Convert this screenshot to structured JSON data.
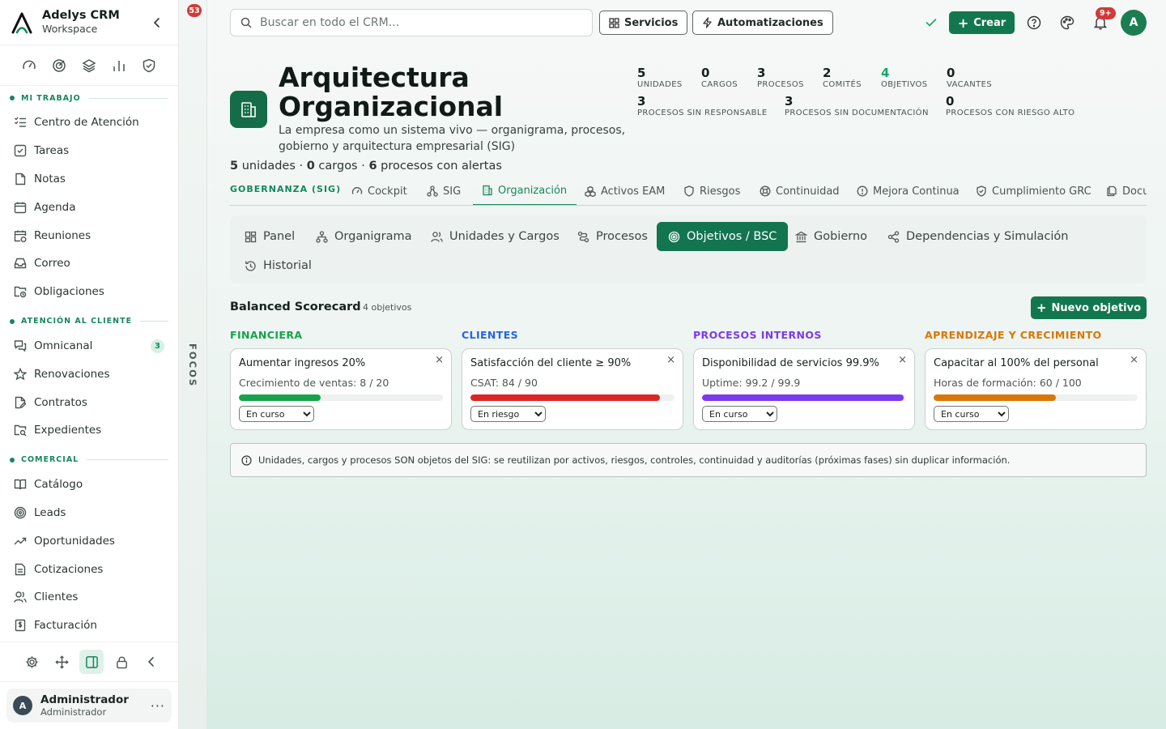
{
  "brand": {
    "name": "Adelys CRM",
    "sub": "Workspace"
  },
  "sidebar": {
    "sections": [
      {
        "label": "MI TRABAJO",
        "items": [
          {
            "label": "Centro de Atención",
            "icon": "list-check-icon"
          },
          {
            "label": "Tareas",
            "icon": "checkbox-icon"
          },
          {
            "label": "Notas",
            "icon": "note-icon"
          },
          {
            "label": "Agenda",
            "icon": "calendar-icon"
          },
          {
            "label": "Reuniones",
            "icon": "calendar-clock-icon"
          },
          {
            "label": "Correo",
            "icon": "inbox-icon"
          },
          {
            "label": "Obligaciones",
            "icon": "folder-clock-icon"
          }
        ]
      },
      {
        "label": "ATENCIÓN AL CLIENTE",
        "items": [
          {
            "label": "Omnicanal",
            "icon": "chat-icon",
            "badge": "3"
          },
          {
            "label": "Renovaciones",
            "icon": "star-icon"
          },
          {
            "label": "Contratos",
            "icon": "contract-icon"
          },
          {
            "label": "Expedientes",
            "icon": "folder-search-icon"
          }
        ]
      },
      {
        "label": "COMERCIAL",
        "items": [
          {
            "label": "Catálogo",
            "icon": "book-icon"
          },
          {
            "label": "Leads",
            "icon": "target-icon"
          },
          {
            "label": "Oportunidades",
            "icon": "trend-icon"
          },
          {
            "label": "Cotizaciones",
            "icon": "quote-doc-icon"
          },
          {
            "label": "Clientes",
            "icon": "users-icon"
          },
          {
            "label": "Facturación",
            "icon": "invoice-icon"
          }
        ]
      }
    ]
  },
  "user": {
    "initial": "A",
    "name": "Administrador",
    "role": "Administrador"
  },
  "focus": {
    "badge": "53",
    "label": "FOCOS"
  },
  "topbar": {
    "search_placeholder": "Buscar en todo el CRM...",
    "services_label": "Servicios",
    "automations_label": "Automatizaciones",
    "create_label": "Crear",
    "notif_badge": "9+",
    "avatar_initial": "A"
  },
  "hero": {
    "title": "Arquitectura Organizacional",
    "description": "La empresa como un sistema vivo — organigrama, procesos, gobierno y arquitectura empresarial (SIG)",
    "summary": {
      "units": "5",
      "units_label": "unidades",
      "positions": "0",
      "positions_label": "cargos",
      "alerts": "6",
      "alerts_label": "procesos con alertas"
    }
  },
  "stats": [
    {
      "value": "5",
      "label": "UNIDADES"
    },
    {
      "value": "0",
      "label": "CARGOS"
    },
    {
      "value": "3",
      "label": "PROCESOS"
    },
    {
      "value": "2",
      "label": "COMITÉS"
    },
    {
      "value": "4",
      "label": "OBJETIVOS"
    },
    {
      "value": "0",
      "label": "VACANTES"
    },
    {
      "value": "3",
      "label": "PROCESOS SIN RESPONSABLE"
    },
    {
      "value": "3",
      "label": "PROCESOS SIN DOCUMENTACIÓN"
    },
    {
      "value": "0",
      "label": "PROCESOS CON RIESGO ALTO"
    }
  ],
  "gov": {
    "label": "GOBERNANZA (SIG)",
    "tabs": [
      "Cockpit",
      "SIG",
      "Organización",
      "Activos EAM",
      "Riesgos",
      "Continuidad",
      "Mejora Continua",
      "Cumplimiento GRC",
      "Docu"
    ]
  },
  "subtabs": [
    "Panel",
    "Organigrama",
    "Unidades y Cargos",
    "Procesos",
    "Objetivos / BSC",
    "Gobierno",
    "Dependencias y Simulación",
    "Historial"
  ],
  "bsc": {
    "title": "Balanced Scorecard",
    "count": "4 objetivos",
    "new_label": "Nuevo objetivo",
    "columns": [
      {
        "title": "FINANCIERA",
        "color": "#16a34a",
        "objective": "Aumentar ingresos 20%",
        "metric": "Crecimiento de ventas: 8 / 20",
        "progress": 0.4,
        "status": "En curso"
      },
      {
        "title": "CLIENTES",
        "color": "#2563eb",
        "bar_color": "#dc2626",
        "objective": "Satisfacción del cliente ≥ 90%",
        "metric": "CSAT: 84 / 90",
        "progress": 0.93,
        "status": "En riesgo"
      },
      {
        "title": "PROCESOS INTERNOS",
        "color": "#7c3aed",
        "objective": "Disponibilidad de servicios 99.9%",
        "metric": "Uptime: 99.2 / 99.9",
        "progress": 0.99,
        "status": "En curso"
      },
      {
        "title": "APRENDIZAJE Y CRECIMIENTO",
        "color": "#d97706",
        "objective": "Capacitar al 100% del personal",
        "metric": "Horas de formación: 60 / 100",
        "progress": 0.6,
        "status": "En curso"
      }
    ],
    "status_options": [
      "En curso",
      "En riesgo"
    ]
  },
  "info": "Unidades, cargos y procesos SON objetos del SIG: se reutilizan por activos, riesgos, controles, continuidad y auditorías (próximas fases) sin duplicar información."
}
